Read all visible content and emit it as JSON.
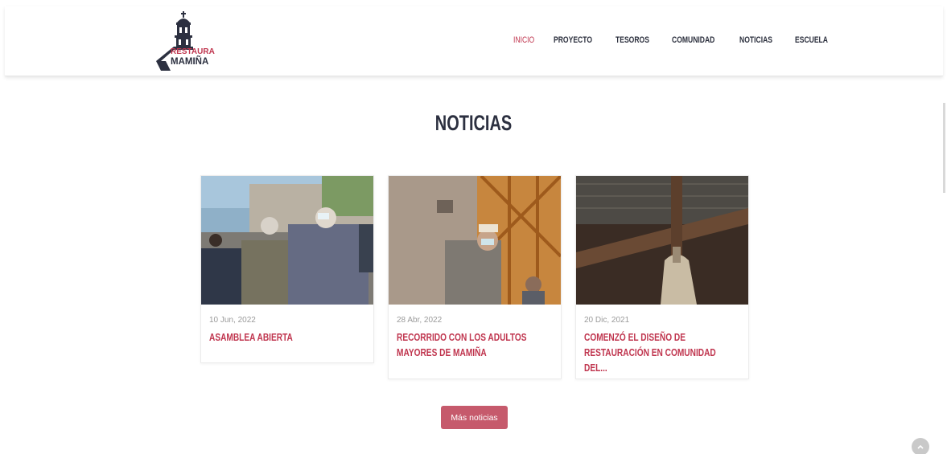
{
  "header": {
    "logo": {
      "line1": "RESTAURA",
      "line2": "MAMIÑA"
    },
    "nav": [
      {
        "label": "INICIO",
        "active": true
      },
      {
        "label": "PROYECTO",
        "active": false
      },
      {
        "label": "TESOROS",
        "active": false
      },
      {
        "label": "COMUNIDAD",
        "active": false
      },
      {
        "label": "NOTICIAS",
        "active": false
      },
      {
        "label": "ESCUELA",
        "active": false
      }
    ]
  },
  "section": {
    "title": "NOTICIAS"
  },
  "news": [
    {
      "date": "10 Jun, 2022",
      "title_lines": [
        "ASAMBLEA ABIERTA"
      ]
    },
    {
      "date": "28 Abr, 2022",
      "title_lines": [
        "RECORRIDO CON LOS ADULTOS",
        "MAYORES DE MAMIÑA"
      ]
    },
    {
      "date": "20 Dic, 2021",
      "title_lines": [
        "COMENZÓ EL DISEÑO DE",
        "RESTAURACIÓN EN COMUNIDAD DEL..."
      ]
    }
  ],
  "more_button": {
    "label": "Más noticias"
  },
  "colors": {
    "accent": "#c0364f",
    "button": "#c65a6c",
    "text_dark": "#2c3040",
    "date": "#9a9a9a"
  },
  "icons": {
    "logo": "church-tower-logo-icon",
    "scroll_top": "chevron-up-icon"
  }
}
